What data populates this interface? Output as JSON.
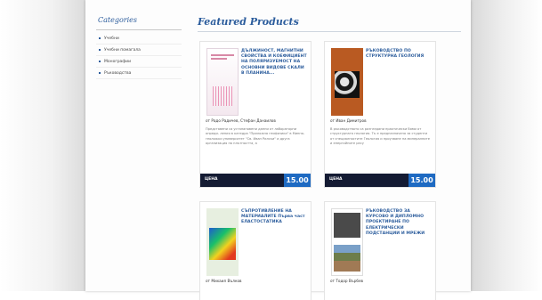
{
  "sidebar": {
    "title": "Categories",
    "items": [
      {
        "label": "Учебни"
      },
      {
        "label": "Учебни помагала"
      },
      {
        "label": "Монографии"
      },
      {
        "label": "Ръководства"
      }
    ]
  },
  "featured": {
    "title": "Featured Products",
    "products": [
      {
        "title": "ДЪЛЖИНОСТ, МАГНИТНИ СВОЙСТВА И КОЕФИЦИЕНТ НА ПОЛЯРИЗУЕМОСТ НА ОСНОВНИ ВИДОВЕ СКАЛИ В ПЛАНИНА...",
        "author": "от Радо Радичев, Стефан Данаилов",
        "description": "Представени са устанановени данни от лабораторни опреди- ления в катедра \"Приложна геофизика\" в Минно-геоложки университет \"Св. Иван Рилски\" и друга организация на плътността, а",
        "price_label": "ЦЕНА",
        "price": "15.00"
      },
      {
        "title": "РЪКОВОДСТВО ПО СТРУКТУРНА ГЕОЛОГИЯ",
        "author": "от Иван Димитров",
        "description": "В ръководството са разгледани практически бями от структурната геология. Тъ е предназначено за студенти от специалностите Геология и проучване на минералните и енергийните ресу",
        "price_label": "ЦЕНА",
        "price": "15.00"
      },
      {
        "title": "СЪПРОТИВЛЕНИЕ НА МАТЕРИАЛИТЕ Първа част ЕЛАСТОСТАТИКА",
        "author": "от Михаил Вълков",
        "description": "",
        "price_label": "",
        "price": ""
      },
      {
        "title": "РЪКОВОДСТВО ЗА КУРСОВО И ДИПЛОМНО ПРОЕКТИРАНЕ ПО ЕЛЕКТРИЧЕСКИ ПОДСТАНЦИИ И МРЕЖИ",
        "author": "от Тодор Върбев",
        "description": "",
        "price_label": "",
        "price": ""
      }
    ]
  },
  "colors": {
    "accent": "#2b5c9c",
    "price_bar": "#141b33",
    "price_badge": "#1e6ac2"
  }
}
